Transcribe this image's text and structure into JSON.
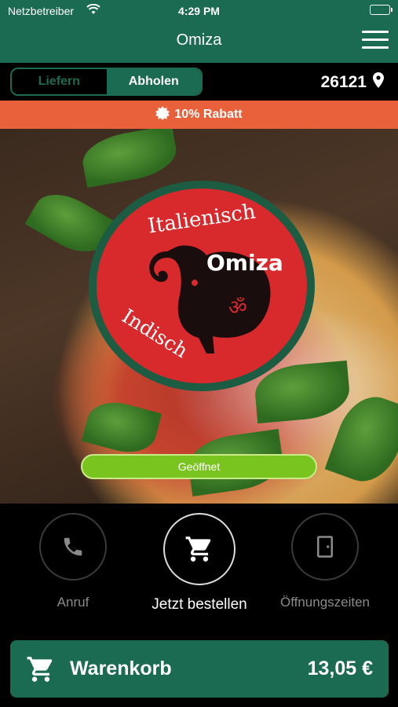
{
  "status_bar": {
    "carrier": "Netzbetreiber",
    "time": "4:29 PM"
  },
  "header": {
    "title": "Omiza"
  },
  "order_mode": {
    "delivery_label": "Liefern",
    "pickup_label": "Abholen",
    "selected": "Abholen"
  },
  "location": {
    "zip": "26121"
  },
  "promo": {
    "text": "10% Rabatt",
    "color": "#e8613a"
  },
  "logo": {
    "top_text": "Italienisch",
    "name": "Omiza",
    "bottom_text": "Indisch"
  },
  "open_status": {
    "label": "Geöffnet",
    "color": "#7ac41f"
  },
  "actions": {
    "call_label": "Anruf",
    "order_label": "Jetzt bestellen",
    "hours_label": "Öffnungszeiten"
  },
  "cart": {
    "label": "Warenkorb",
    "total": "13,05 €"
  },
  "colors": {
    "brand": "#1b6a52",
    "promo": "#e8613a",
    "open": "#7ac41f"
  }
}
